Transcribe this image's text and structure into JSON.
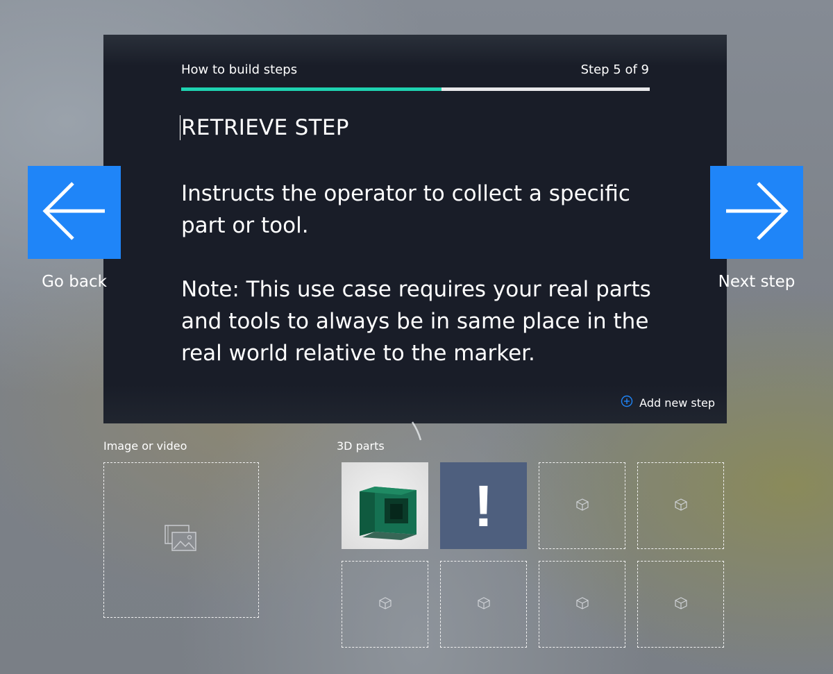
{
  "header": {
    "title": "How to build steps",
    "step_counter": "Step 5 of 9",
    "progress_fraction": 0.556
  },
  "step": {
    "heading": "RETRIEVE STEP",
    "paragraphs": [
      "Instructs the operator to collect a specific part or tool.",
      "Note: This use case requires your real parts and tools to always be in same place in the real world relative to the marker."
    ]
  },
  "actions": {
    "add_new_step": "Add new step"
  },
  "navigation": {
    "back_label": "Go back",
    "next_label": "Next step"
  },
  "media": {
    "label": "Image or video"
  },
  "parts": {
    "label": "3D parts",
    "warning_symbol": "!"
  },
  "colors": {
    "accent_blue": "#1f85f8",
    "progress_teal": "#1fd3b1",
    "card_bg": "#191d28",
    "warning_tile": "#4e5f7e"
  }
}
